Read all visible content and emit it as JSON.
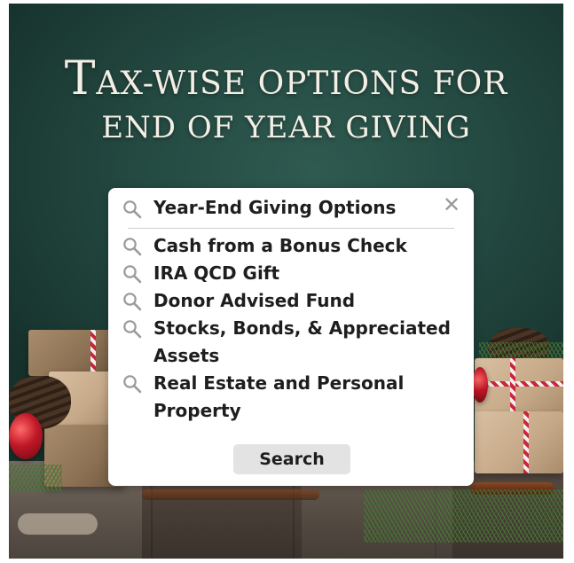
{
  "headline": {
    "line1_initial": "T",
    "line1_rest": "AX-WISE OPTIONS FOR",
    "line2": "END OF YEAR GIVING"
  },
  "search": {
    "query": "Year-End Giving Options",
    "clear_symbol": "✕",
    "results": [
      "Cash from a Bonus Check",
      "IRA QCD Gift",
      "Donor Advised Fund",
      "Stocks, Bonds, & Appreciated Assets",
      "Real Estate and Personal Property"
    ],
    "button_label": "Search"
  },
  "icons": {
    "search": "search-icon",
    "clear": "close-icon"
  },
  "colors": {
    "background_green": "#244a42",
    "headline_text": "#f4efe6",
    "panel": "#ffffff",
    "icon_gray": "#9a9a9a",
    "button": "#e3e3e3",
    "ribbon_red": "#c9263a"
  }
}
